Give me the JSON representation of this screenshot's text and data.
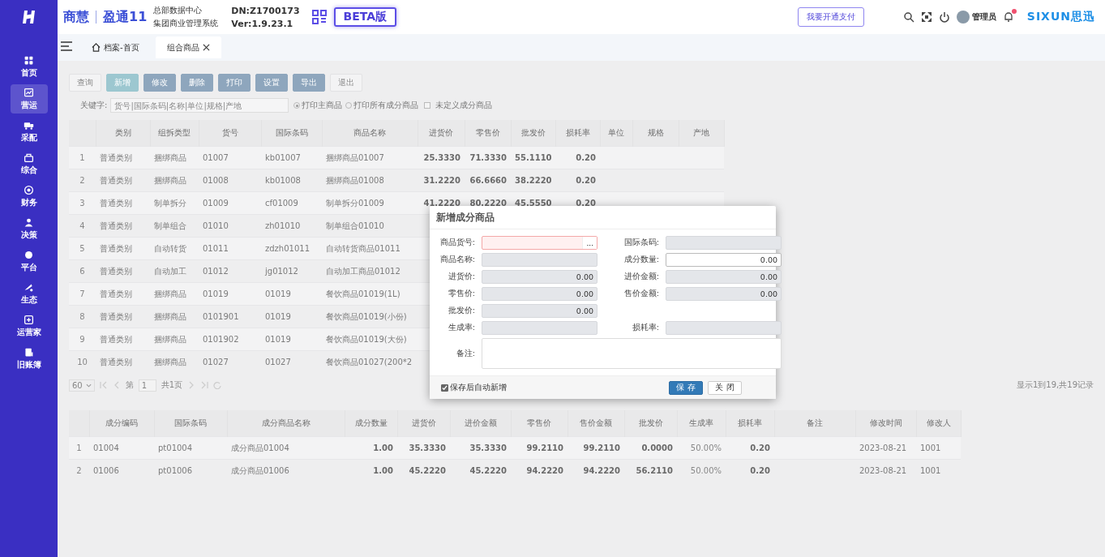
{
  "brand": {
    "name": "商慧",
    "product": "盈通11",
    "org": "总部数据中心",
    "system": "集团商业管理系统",
    "dn": "DN:Z1700173",
    "version": "Ver:1.9.23.1",
    "beta": "BETA版"
  },
  "header": {
    "pay_button": "我要开通支付",
    "user": "管理员",
    "notification": true,
    "vendor": "SIXUN思迅"
  },
  "sidebar": {
    "items": [
      {
        "label": "首页",
        "selected": false
      },
      {
        "label": "营运",
        "selected": true
      },
      {
        "label": "采配",
        "selected": false
      },
      {
        "label": "综合",
        "selected": false
      },
      {
        "label": "财务",
        "selected": false
      },
      {
        "label": "决策",
        "selected": false
      },
      {
        "label": "平台",
        "selected": false
      },
      {
        "label": "生态",
        "selected": false
      },
      {
        "label": "运营家",
        "selected": false
      },
      {
        "label": "旧账簿",
        "selected": false
      }
    ]
  },
  "tabs": [
    {
      "label": "档案-首页",
      "kind": "home",
      "selected": false
    },
    {
      "label": "组合商品",
      "kind": "closable",
      "selected": true
    }
  ],
  "toolbar": [
    {
      "label": "查询",
      "kind": "plain"
    },
    {
      "label": "新增",
      "kind": "accent"
    },
    {
      "label": "修改",
      "kind": "primary"
    },
    {
      "label": "删除",
      "kind": "primary"
    },
    {
      "label": "打印",
      "kind": "primary"
    },
    {
      "label": "设置",
      "kind": "primary"
    },
    {
      "label": "导出",
      "kind": "primary"
    },
    {
      "label": "退出",
      "kind": "plain"
    }
  ],
  "filter": {
    "label": "关键字:",
    "placeholder": "货号|国际条码|名称|单位|规格|产地",
    "radios": [
      {
        "label": "打印主商品",
        "selected": true
      },
      {
        "label": "打印所有成分商品",
        "selected": false
      }
    ],
    "checkbox": {
      "label": "未定义成分商品",
      "checked": false
    }
  },
  "table": {
    "columns": [
      {
        "label": "类别",
        "kind": "text"
      },
      {
        "label": "组拆类型",
        "kind": "text"
      },
      {
        "label": "货号",
        "kind": "text"
      },
      {
        "label": "国际条码",
        "kind": "text"
      },
      {
        "label": "商品名称",
        "kind": "text"
      },
      {
        "label": "进货价",
        "kind": "number"
      },
      {
        "label": "零售价",
        "kind": "number"
      },
      {
        "label": "批发价",
        "kind": "number"
      },
      {
        "label": "损耗率",
        "kind": "number"
      },
      {
        "label": "单位",
        "kind": "text"
      },
      {
        "label": "规格",
        "kind": "text"
      },
      {
        "label": "产地",
        "kind": "text"
      }
    ],
    "rows": [
      {
        "index": "1",
        "cells": [
          "普通类别",
          "捆绑商品",
          "01007",
          "kb01007",
          "捆绑商品01007",
          "25.3330",
          "71.3330",
          "55.1110",
          "0.20"
        ]
      },
      {
        "index": "2",
        "cells": [
          "普通类别",
          "捆绑商品",
          "01008",
          "kb01008",
          "捆绑商品01008",
          "31.2220",
          "66.6660",
          "38.2220",
          "0.20"
        ]
      },
      {
        "index": "3",
        "cells": [
          "普通类别",
          "制单拆分",
          "01009",
          "cf01009",
          "制单拆分01009",
          "41.2220",
          "80.2220",
          "45.5550",
          "0.20"
        ]
      },
      {
        "index": "4",
        "cells": [
          "普通类别",
          "制单组合",
          "01010",
          "zh01010",
          "制单组合01010"
        ]
      },
      {
        "index": "5",
        "cells": [
          "普通类别",
          "自动转货",
          "01011",
          "zdzh01011",
          "自动转货商品01011"
        ]
      },
      {
        "index": "6",
        "cells": [
          "普通类别",
          "自动加工",
          "01012",
          "jg01012",
          "自动加工商品01012"
        ]
      },
      {
        "index": "7",
        "cells": [
          "普通类别",
          "捆绑商品",
          "01019",
          "01019",
          "餐饮商品01019(1L)"
        ]
      },
      {
        "index": "8",
        "cells": [
          "普通类别",
          "捆绑商品",
          "0101901",
          "01019",
          "餐饮商品01019(小份)"
        ]
      },
      {
        "index": "9",
        "cells": [
          "普通类别",
          "捆绑商品",
          "0101902",
          "01019",
          "餐饮商品01019(大份)"
        ]
      },
      {
        "index": "10",
        "cells": [
          "普通类别",
          "捆绑商品",
          "01027",
          "01027",
          "餐饮商品01027(200*2"
        ]
      }
    ]
  },
  "pager": {
    "page_size": "60",
    "page_prefix": "第",
    "page": "1",
    "total_pages": "共1页",
    "summary": "显示1到19,共19记录"
  },
  "components": {
    "columns": [
      {
        "label": "成分编码",
        "kind": "text"
      },
      {
        "label": "国际条码",
        "kind": "text"
      },
      {
        "label": "成分商品名称",
        "kind": "text"
      },
      {
        "label": "成分数量",
        "kind": "number"
      },
      {
        "label": "进货价",
        "kind": "number"
      },
      {
        "label": "进价金额",
        "kind": "number"
      },
      {
        "label": "零售价",
        "kind": "number"
      },
      {
        "label": "售价金额",
        "kind": "number"
      },
      {
        "label": "批发价",
        "kind": "number"
      },
      {
        "label": "生成率",
        "kind": "rate"
      },
      {
        "label": "损耗率",
        "kind": "number"
      },
      {
        "label": "备注",
        "kind": "text"
      },
      {
        "label": "修改时间",
        "kind": "text"
      },
      {
        "label": "修改人",
        "kind": "text"
      }
    ],
    "rows": [
      {
        "index": "1",
        "code": "01004",
        "barcode": "pt01004",
        "name": "成分商品01004",
        "qty": "1.00",
        "purchase_price": "35.3330",
        "purchase_amount": "35.3330",
        "retail_price": "99.2110",
        "retail_amount": "99.2110",
        "wholesale_price": "0.0000",
        "yield_rate": "50.00%",
        "loss_rate": "0.20",
        "modified_time": "2023-08-21",
        "modified_by": "1001"
      },
      {
        "index": "2",
        "code": "01006",
        "barcode": "pt01006",
        "name": "成分商品01006",
        "qty": "1.00",
        "purchase_price": "45.2220",
        "purchase_amount": "45.2220",
        "retail_price": "94.2220",
        "retail_amount": "94.2220",
        "wholesale_price": "56.2110",
        "yield_rate": "50.00%",
        "loss_rate": "0.20",
        "modified_time": "2023-08-21",
        "modified_by": "1001"
      }
    ]
  },
  "dialog": {
    "title": "新增成分商品",
    "fields": [
      {
        "label": "商品货号:",
        "kind": "picker",
        "editable": true,
        "invalid": true,
        "picker_label": "..."
      },
      {
        "label": "国际条码:",
        "kind": "input",
        "editable": false,
        "invalid": false
      },
      {
        "label": "商品名称:",
        "kind": "input",
        "editable": false,
        "invalid": false
      },
      {
        "label": "成分数量:",
        "kind": "input",
        "editable": true,
        "invalid": false,
        "value": "0.00"
      },
      {
        "label": "进货价:",
        "kind": "input",
        "editable": false,
        "invalid": false,
        "value": "0.00"
      },
      {
        "label": "进价金额:",
        "kind": "input",
        "editable": false,
        "invalid": false,
        "value": "0.00"
      },
      {
        "label": "零售价:",
        "kind": "input",
        "editable": false,
        "invalid": false,
        "value": "0.00"
      },
      {
        "label": "售价金额:",
        "kind": "input",
        "editable": false,
        "invalid": false,
        "value": "0.00"
      },
      {
        "label": "批发价:",
        "kind": "input",
        "editable": false,
        "invalid": false,
        "value": "0.00"
      },
      {
        "kind": "blank"
      },
      {
        "label": "生成率:",
        "kind": "input",
        "editable": false,
        "invalid": false
      },
      {
        "label": "损耗率:",
        "kind": "input",
        "editable": false,
        "invalid": false
      },
      {
        "label": "备注:",
        "kind": "textarea",
        "editable": true,
        "invalid": false
      }
    ],
    "auto_new": {
      "label": "保存后自动新增",
      "checked": true
    },
    "buttons": [
      {
        "label": "保 存",
        "kind": "primary"
      },
      {
        "label": "关 闭",
        "kind": "plain"
      }
    ]
  }
}
